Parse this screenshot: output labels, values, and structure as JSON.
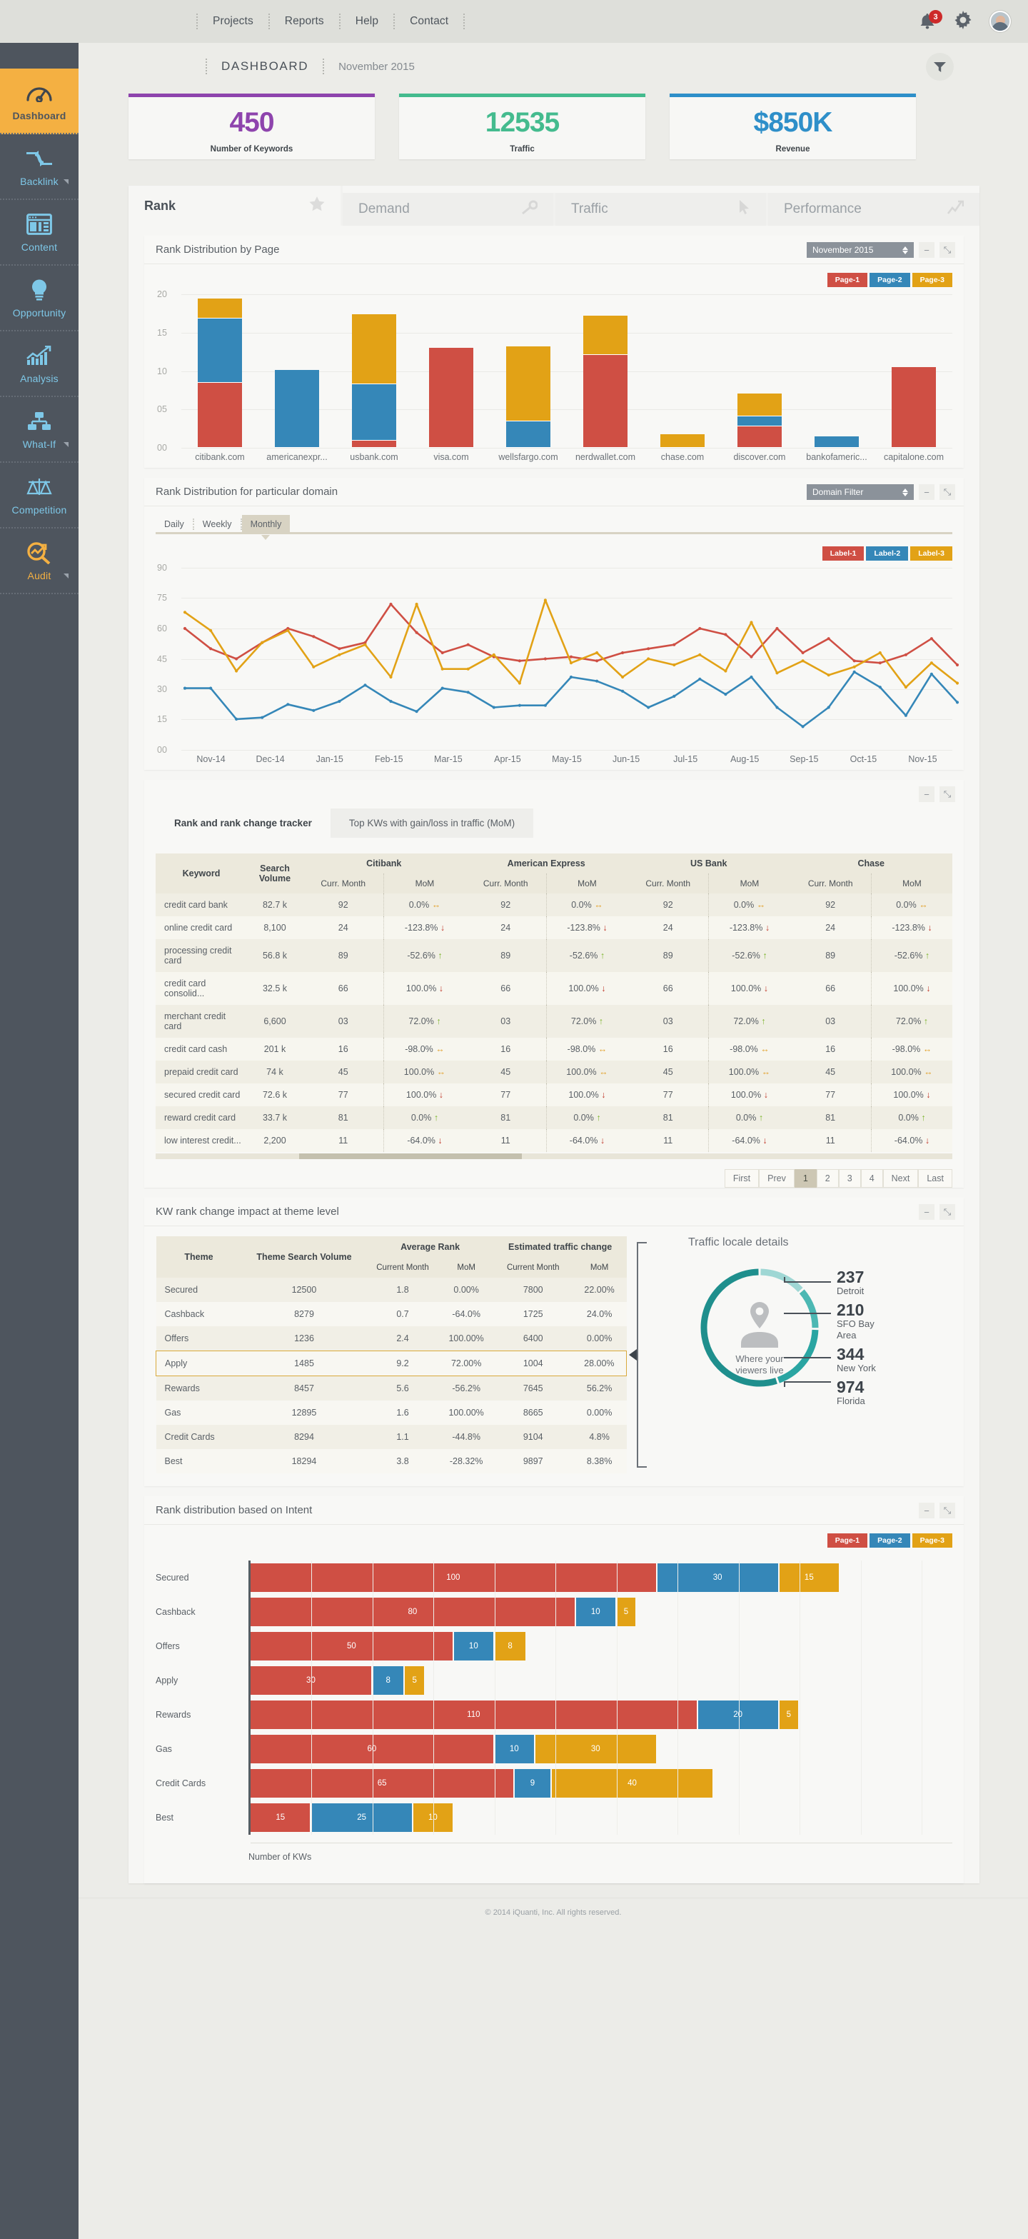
{
  "topbar": {
    "nav": [
      "Projects",
      "Reports",
      "Help",
      "Contact"
    ],
    "notification_count": "3",
    "icons": {
      "bell": "bell-icon",
      "gear": "gear-icon",
      "avatar": "avatar"
    }
  },
  "page_header": {
    "title": "DASHBOARD",
    "date": "November 2015",
    "filter": "filter-icon"
  },
  "kpis": [
    {
      "value": "450",
      "label": "Number of Keywords",
      "color": "#8e44ad"
    },
    {
      "value": "12535",
      "label": "Traffic",
      "color": "#44bb8e"
    },
    {
      "value": "$850K",
      "label": "Revenue",
      "color": "#2e8fc9"
    }
  ],
  "tabs": [
    {
      "label": "Rank",
      "icon": "star-icon",
      "active": true
    },
    {
      "label": "Demand",
      "icon": "key-icon",
      "active": false
    },
    {
      "label": "Traffic",
      "icon": "cursor-icon",
      "active": false
    },
    {
      "label": "Performance",
      "icon": "trend-icon",
      "active": false
    }
  ],
  "card1": {
    "title": "Rank Distribution by Page",
    "select_value": "November 2015",
    "minimize": "−",
    "expand": "⤡"
  },
  "card2": {
    "title": "Rank Distribution for particular domain",
    "select_value": "Domain Filter",
    "granularity": [
      "Daily",
      "Weekly",
      "Monthly"
    ],
    "granularity_selected": "Monthly"
  },
  "card3": {
    "tabs": [
      "Rank and rank change tracker",
      "Top KWs with gain/loss in traffic (MoM)"
    ],
    "active_tab": "Rank and rank change tracker",
    "columns": {
      "keyword": "Keyword",
      "volume": "Search Volume",
      "banks": [
        "Citibank",
        "American Express",
        "US Bank",
        "Chase"
      ],
      "sub": [
        "Curr. Month",
        "MoM"
      ]
    },
    "rows": [
      {
        "keyword": "credit card bank",
        "volume": "82.7 k",
        "rank": "92",
        "mom": "0.0%",
        "dir": "flat"
      },
      {
        "keyword": "online credit card",
        "volume": "8,100",
        "rank": "24",
        "mom": "-123.8%",
        "dir": "down"
      },
      {
        "keyword": "processing credit card",
        "volume": "56.8 k",
        "rank": "89",
        "mom": "-52.6%",
        "dir": "up"
      },
      {
        "keyword": "credit card consolid...",
        "volume": "32.5 k",
        "rank": "66",
        "mom": "100.0%",
        "dir": "down"
      },
      {
        "keyword": "merchant credit card",
        "volume": "6,600",
        "rank": "03",
        "mom": "72.0%",
        "dir": "up"
      },
      {
        "keyword": "credit card cash",
        "volume": "201 k",
        "rank": "16",
        "mom": "-98.0%",
        "dir": "flat"
      },
      {
        "keyword": "prepaid credit card",
        "volume": "74 k",
        "rank": "45",
        "mom": "100.0%",
        "dir": "flat"
      },
      {
        "keyword": "secured credit card",
        "volume": "72.6 k",
        "rank": "77",
        "mom": "100.0%",
        "dir": "down"
      },
      {
        "keyword": "reward credit card",
        "volume": "33.7 k",
        "rank": "81",
        "mom": "0.0%",
        "dir": "up"
      },
      {
        "keyword": "low interest credit...",
        "volume": "2,200",
        "rank": "11",
        "mom": "-64.0%",
        "dir": "down"
      }
    ],
    "pager": [
      "First",
      "Prev",
      "1",
      "2",
      "3",
      "4",
      "Next",
      "Last"
    ],
    "pager_active": "1"
  },
  "card4": {
    "title": "KW rank change impact at theme level",
    "columns": {
      "theme": "Theme",
      "volume": "Theme Search Volume",
      "avg_rank": "Average Rank",
      "traffic": "Estimated traffic change",
      "sub": [
        "Current Month",
        "MoM"
      ]
    },
    "rows": [
      {
        "theme": "Secured",
        "volume": "12500",
        "rank": "1.8",
        "rank_mom": "0.00%",
        "traffic": "7800",
        "traffic_mom": "22.00%",
        "highlight": false
      },
      {
        "theme": "Cashback",
        "volume": "8279",
        "rank": "0.7",
        "rank_mom": "-64.0%",
        "traffic": "1725",
        "traffic_mom": "24.0%",
        "highlight": false
      },
      {
        "theme": "Offers",
        "volume": "1236",
        "rank": "2.4",
        "rank_mom": "100.00%",
        "traffic": "6400",
        "traffic_mom": "0.00%",
        "highlight": false
      },
      {
        "theme": "Apply",
        "volume": "1485",
        "rank": "9.2",
        "rank_mom": "72.00%",
        "traffic": "1004",
        "traffic_mom": "28.00%",
        "highlight": true
      },
      {
        "theme": "Rewards",
        "volume": "8457",
        "rank": "5.6",
        "rank_mom": "-56.2%",
        "traffic": "7645",
        "traffic_mom": "56.2%",
        "highlight": false
      },
      {
        "theme": "Gas",
        "volume": "12895",
        "rank": "1.6",
        "rank_mom": "100.00%",
        "traffic": "8665",
        "traffic_mom": "0.00%",
        "highlight": false
      },
      {
        "theme": "Credit Cards",
        "volume": "8294",
        "rank": "1.1",
        "rank_mom": "-44.8%",
        "traffic": "9104",
        "traffic_mom": "4.8%",
        "highlight": false
      },
      {
        "theme": "Best",
        "volume": "18294",
        "rank": "3.8",
        "rank_mom": "-28.32%",
        "traffic": "9897",
        "traffic_mom": "8.38%",
        "highlight": false
      }
    ],
    "locale": {
      "title": "Traffic locale details",
      "center_line1": "Where your",
      "center_line2": "viewers live",
      "entries": [
        {
          "value": "237",
          "label": "Detroit"
        },
        {
          "value": "210",
          "label": "SFO Bay Area"
        },
        {
          "value": "344",
          "label": "New York"
        },
        {
          "value": "974",
          "label": "Florida"
        }
      ]
    }
  },
  "card5": {
    "title": "Rank distribution based on Intent"
  },
  "footer": {
    "text": "© 2014 iQuanti, Inc. All rights reserved."
  },
  "sidebar": {
    "items": [
      {
        "label": "Dashboard",
        "icon": "gauge-icon",
        "active": true,
        "caret": false
      },
      {
        "label": "Backlink",
        "icon": "link-icon",
        "active": false,
        "caret": true
      },
      {
        "label": "Content",
        "icon": "layout-icon",
        "active": false,
        "caret": false
      },
      {
        "label": "Opportunity",
        "icon": "bulb-icon",
        "active": false,
        "caret": false
      },
      {
        "label": "Analysis",
        "icon": "barchart-icon",
        "active": false,
        "caret": false
      },
      {
        "label": "What-If",
        "icon": "sitemap-icon",
        "active": false,
        "caret": true
      },
      {
        "label": "Competition",
        "icon": "scales-icon",
        "active": false,
        "caret": false
      },
      {
        "label": "Audit",
        "icon": "magnifier-icon",
        "active": false,
        "caret": true
      }
    ]
  },
  "palette": {
    "page1": "#cf4f44",
    "page2": "#3587b8",
    "page3": "#e2a216",
    "teal": "#2aa5a2"
  },
  "chart_data": [
    {
      "type": "bar",
      "title": "Rank Distribution by Page",
      "stacked": true,
      "legend": [
        "Page-1",
        "Page-2",
        "Page-3"
      ],
      "legend_position": "top-right",
      "colors": [
        "#cf4f44",
        "#3587b8",
        "#e2a216"
      ],
      "categories": [
        "citibank.com",
        "americanexpr...",
        "usbank.com",
        "visa.com",
        "wellsfargo.com",
        "nerdwallet.com",
        "chase.com",
        "discover.com",
        "bankofameric...",
        "capitalone.com"
      ],
      "series": [
        {
          "name": "Page-1",
          "values": [
            8.5,
            0,
            0.9,
            13.0,
            0,
            12.1,
            0,
            2.8,
            0,
            10.5
          ]
        },
        {
          "name": "Page-2",
          "values": [
            8.3,
            10.1,
            7.4,
            0,
            3.4,
            0,
            0,
            1.3,
            1.5,
            0
          ]
        },
        {
          "name": "Page-3",
          "values": [
            2.6,
            0,
            9.1,
            0,
            9.8,
            5.1,
            1.8,
            3.0,
            0,
            0
          ]
        }
      ],
      "ylabel": "",
      "xlabel": "",
      "yticks": [
        "00",
        "05",
        "10",
        "15",
        "20"
      ],
      "ylim": [
        0,
        20
      ],
      "grid": true
    },
    {
      "type": "line",
      "title": "Rank Distribution for particular domain",
      "legend": [
        "Label-1",
        "Label-2",
        "Label-3"
      ],
      "legend_position": "top-right",
      "colors": [
        "#cf4f44",
        "#3587b8",
        "#e2a216"
      ],
      "xticks": [
        "Nov-14",
        "Dec-14",
        "Jan-15",
        "Feb-15",
        "Mar-15",
        "Apr-15",
        "May-15",
        "Jun-15",
        "Jul-15",
        "Aug-15",
        "Sep-15",
        "Oct-15",
        "Nov-15"
      ],
      "yticks": [
        "00",
        "15",
        "30",
        "45",
        "60",
        "75",
        "90"
      ],
      "ylim": [
        0,
        90
      ],
      "grid": true,
      "series": [
        {
          "name": "Label-1",
          "values": [
            60,
            50,
            45,
            53,
            60,
            56,
            50,
            53,
            72,
            58,
            48,
            52,
            46,
            44,
            45,
            46,
            44,
            48,
            50,
            52,
            60,
            57,
            46,
            60,
            48,
            55,
            44,
            43,
            47,
            55,
            42
          ]
        },
        {
          "name": "Label-2",
          "values": [
            30.5,
            30.5,
            15.2,
            16,
            22.5,
            19.5,
            24,
            32,
            24,
            19,
            30.5,
            28.5,
            21,
            22,
            22,
            36,
            34,
            29,
            21,
            26.5,
            35,
            27.5,
            36,
            21,
            11.5,
            21,
            38.5,
            31,
            17,
            37.5,
            23.5
          ]
        },
        {
          "name": "Label-3",
          "values": [
            68,
            59,
            39,
            53,
            59,
            41,
            47,
            52,
            36,
            72,
            40,
            40,
            47,
            33,
            74,
            43,
            48,
            36,
            45,
            42,
            47,
            39,
            63,
            38,
            44,
            37,
            41,
            48,
            31,
            43,
            33
          ]
        }
      ]
    },
    {
      "type": "bar",
      "orientation": "horizontal",
      "stacked": true,
      "title": "Rank distribution based on Intent",
      "legend": [
        "Page-1",
        "Page-2",
        "Page-3"
      ],
      "legend_position": "top-right",
      "colors": [
        "#cf4f44",
        "#3587b8",
        "#e2a216"
      ],
      "xlabel": "Number of KWs",
      "categories": [
        "Secured",
        "Cashback",
        "Offers",
        "Apply",
        "Rewards",
        "Gas",
        "Credit Cards",
        "Best"
      ],
      "series": [
        {
          "name": "Page-1",
          "values": [
            100,
            80,
            50,
            30,
            110,
            60,
            65,
            15
          ]
        },
        {
          "name": "Page-2",
          "values": [
            30,
            10,
            10,
            8,
            20,
            10,
            9,
            25
          ]
        },
        {
          "name": "Page-3",
          "values": [
            15,
            5,
            8,
            5,
            5,
            30,
            40,
            10
          ]
        }
      ],
      "xlim": [
        0,
        165
      ],
      "grid": true
    },
    {
      "type": "pie",
      "subtype": "donut",
      "title": "Traffic locale details",
      "center_text": "Where your viewers live",
      "labels": [
        "Detroit",
        "SFO Bay Area",
        "New York",
        "Florida"
      ],
      "values": [
        237,
        210,
        344,
        974
      ],
      "colors": [
        "#9fd7d4",
        "#4cb8b3",
        "#2aa5a2",
        "#1f8f8d"
      ]
    }
  ]
}
